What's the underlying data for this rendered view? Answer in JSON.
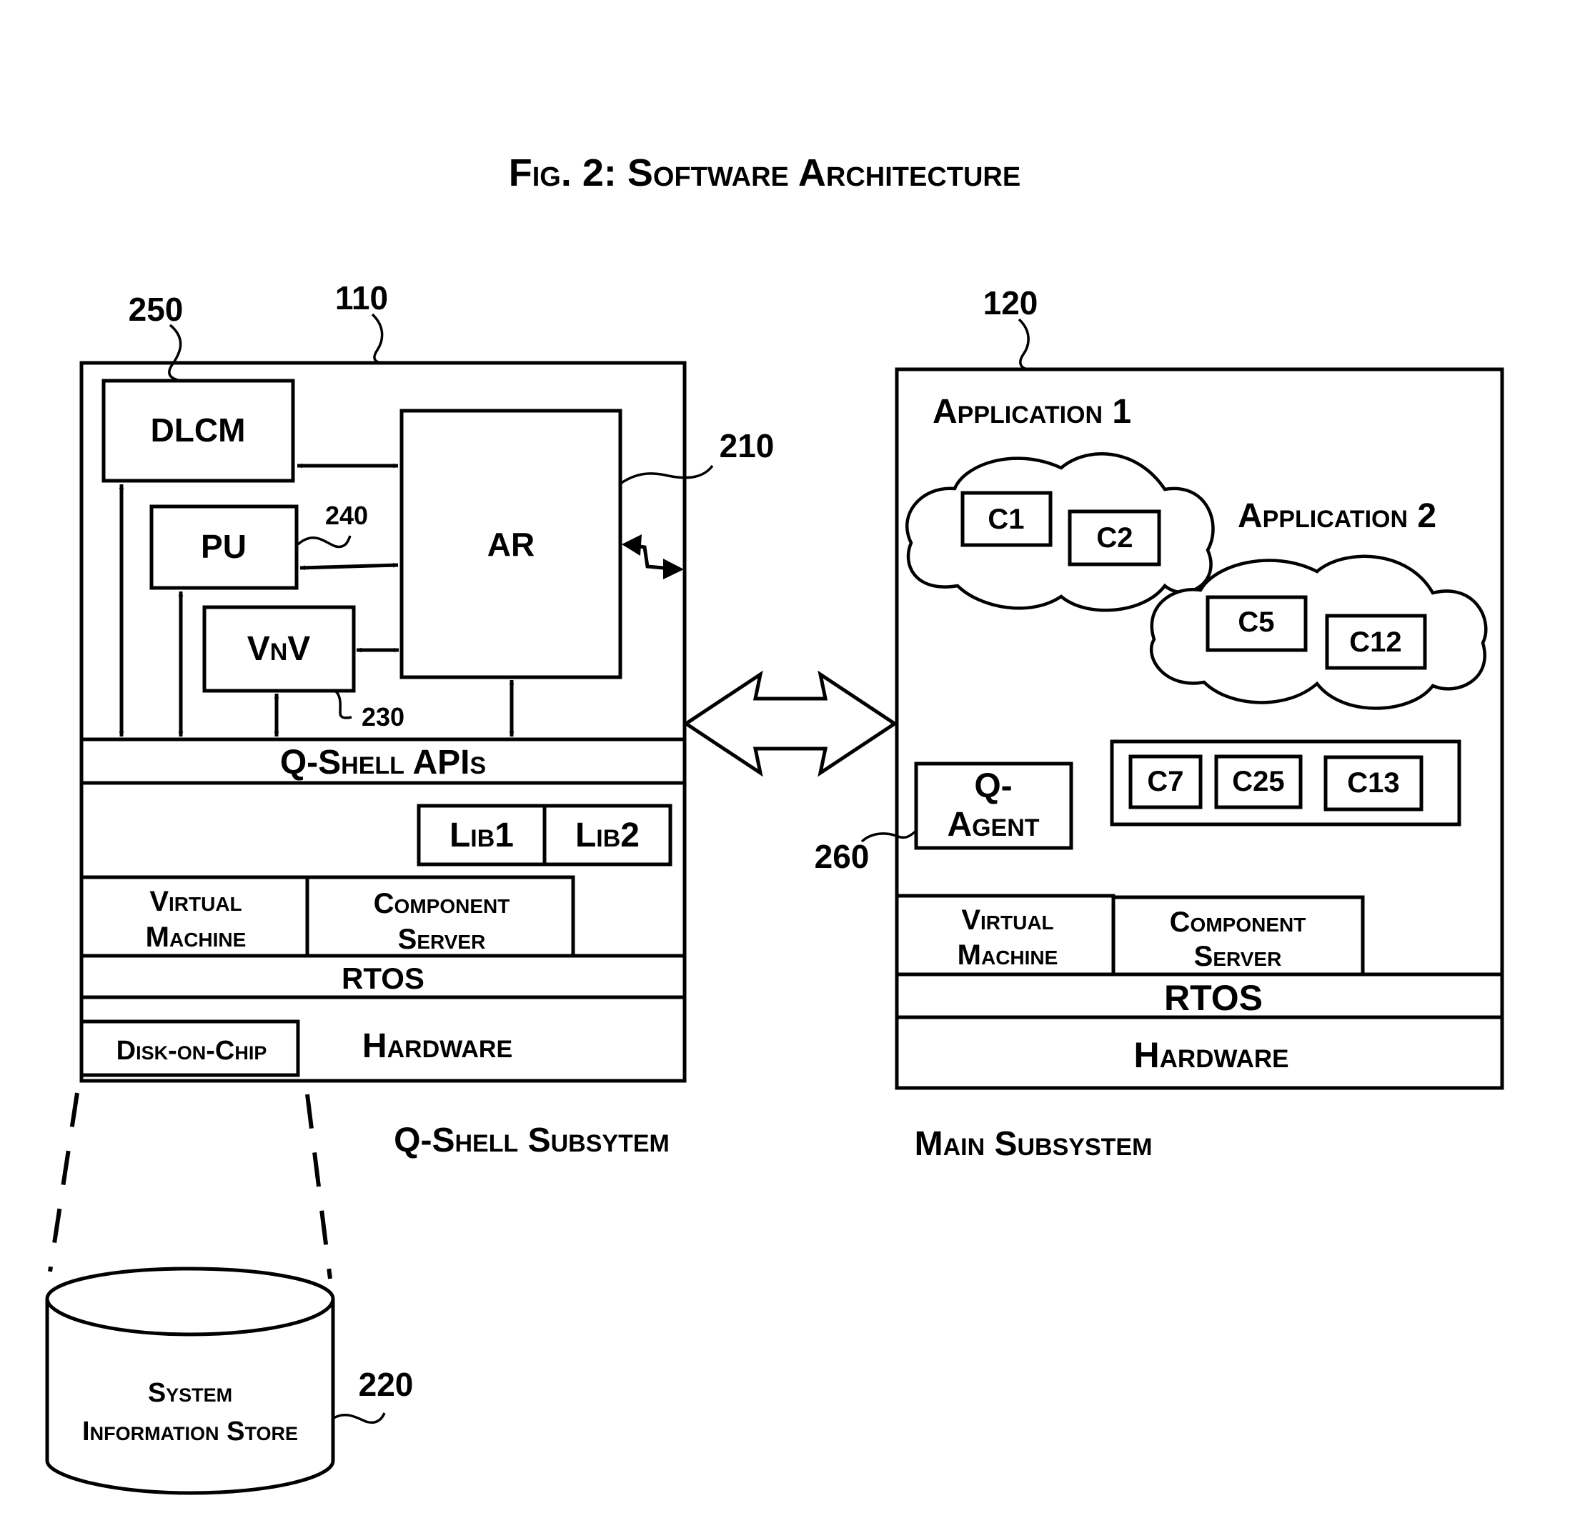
{
  "figure": {
    "title": "Fig. 2: Software Architecture"
  },
  "qshell_subsystem": {
    "ref": "110",
    "caption": "Q-Shell Subsytem",
    "modules": {
      "dlcm": {
        "label": "DLCM",
        "ref": "250"
      },
      "pu": {
        "label": "PU",
        "ref": "240"
      },
      "vnv": {
        "label": "VnV",
        "ref": "230"
      },
      "ar": {
        "label": "AR",
        "ref": "210"
      }
    },
    "apis_label": "Q-Shell APIs",
    "libraries": [
      "Lib1",
      "Lib2"
    ],
    "virtual_machine": [
      "Virtual",
      "Machine"
    ],
    "component_server": [
      "Component",
      "Server"
    ],
    "rtos_label": "RTOS",
    "hardware_label": "Hardware",
    "disk_on_chip_label": "Disk-on-Chip"
  },
  "system_information_store": {
    "ref": "220",
    "lines": [
      "System",
      "Information Store"
    ]
  },
  "main_subsystem": {
    "ref": "120",
    "caption": "Main Subsystem",
    "applications": [
      {
        "label": "Application 1",
        "components": [
          "C1",
          "C2"
        ]
      },
      {
        "label": "Application 2",
        "components": [
          "C5",
          "C12"
        ]
      }
    ],
    "shared_components": [
      "C7",
      "C25",
      "C13"
    ],
    "q_agent": {
      "lines": [
        "Q-",
        "Agent"
      ],
      "ref": "260"
    },
    "virtual_machine": [
      "Virtual",
      "Machine"
    ],
    "component_server": [
      "Component",
      "Server"
    ],
    "rtos_label": "RTOS",
    "hardware_label": "Hardware"
  }
}
